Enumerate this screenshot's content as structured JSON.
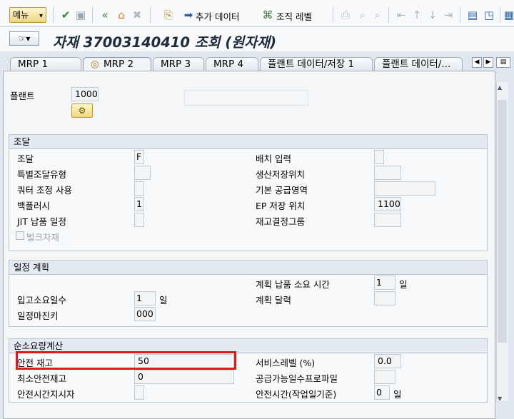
{
  "toolbar": {
    "menu_label": "메뉴",
    "additional_data_label": "추가 데이터",
    "org_levels_label": "조직 레벨"
  },
  "title": "자재 37003140410 조회 (원자재)",
  "tabs": [
    "MRP 1",
    "MRP 2",
    "MRP 3",
    "MRP 4",
    "플랜트 데이터/저장 1",
    "플랜트 데이터/..."
  ],
  "active_tab": "MRP 2",
  "plant": {
    "label": "플랜트",
    "value": "1000"
  },
  "procurement": {
    "header": "조달",
    "left": [
      {
        "label": "조달",
        "value": "F"
      },
      {
        "label": "특별조달유형",
        "value": ""
      },
      {
        "label": "쿼터 조정 사용",
        "value": ""
      },
      {
        "label": "백플러시",
        "value": "1"
      },
      {
        "label": "JIT 납품 일정",
        "value": ""
      }
    ],
    "right": [
      {
        "label": "배치 입력",
        "value": ""
      },
      {
        "label": "생산저장위치",
        "value": ""
      },
      {
        "label": "기본 공급영역",
        "value": ""
      },
      {
        "label": "EP 저장 위치",
        "value": "1100"
      },
      {
        "label": "재고결정그룹",
        "value": ""
      }
    ],
    "bulk_label": "벌크자재"
  },
  "scheduling": {
    "header": "일정 계획",
    "planned_delivery_label": "계획 납품 소요 시간",
    "planned_delivery_value": "1",
    "day_unit": "일",
    "gr_time_label": "입고소요일수",
    "gr_time_value": "1",
    "planning_calendar_label": "계획 달력",
    "planning_calendar_value": "",
    "margin_key_label": "일정마진키",
    "margin_key_value": "000"
  },
  "net_requirements": {
    "header": "순소요량계산",
    "safety_stock_label": "안전 재고",
    "safety_stock_value": "50",
    "min_safety_stock_label": "최소안전재고",
    "min_safety_stock_value": "0",
    "safety_time_ind_label": "안전시간지시자",
    "safety_time_ind_value": "",
    "service_level_label": "서비스레벨 (%)",
    "service_level_value": "0.0",
    "coverage_profile_label": "공급가능일수프로파일",
    "coverage_profile_value": "",
    "safety_time_label": "안전시간(작업일기준)",
    "safety_time_value": "0"
  },
  "colors": {
    "highlight": "#e01a1a",
    "title": "#1d2b3a"
  }
}
